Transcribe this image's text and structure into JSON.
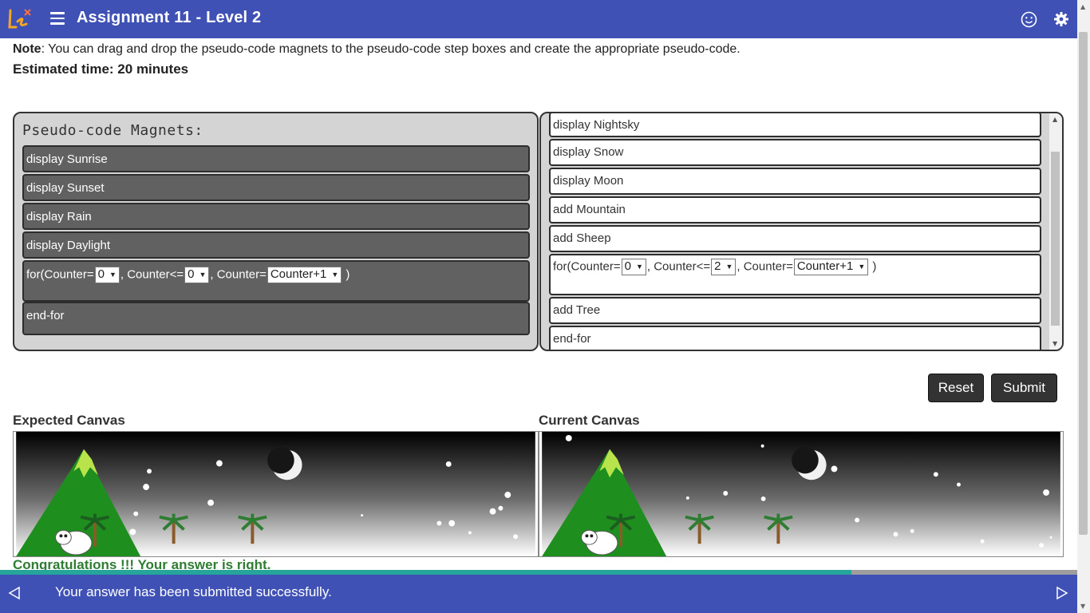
{
  "header": {
    "title": "Assignment 11 - Level 2"
  },
  "note": {
    "label": "Note",
    "text": ": You can drag and drop the pseudo-code magnets to the pseudo-code step boxes and create the appropriate pseudo-code.",
    "estimated": "Estimated time: 20 minutes"
  },
  "magnets": {
    "title": "Pseudo-code Magnets:",
    "items": [
      "display Sunrise",
      "display Sunset",
      "display Rain",
      "display Daylight"
    ],
    "loop": {
      "p1": "for(Counter=",
      "v1": "0",
      "p2": ", Counter<=",
      "v2": "0",
      "p3": ", Counter=",
      "v3": "Counter+1",
      "p4": " )"
    },
    "end": "end-for"
  },
  "steps": {
    "items": [
      "display Nightsky",
      "display Snow",
      "display Moon",
      "add Mountain",
      "add Sheep"
    ],
    "loop": {
      "p1": "for(Counter=",
      "v1": "0",
      "p2": ", Counter<=",
      "v2": "2",
      "p3": ", Counter=",
      "v3": "Counter+1",
      "p4": " )"
    },
    "after": [
      "add Tree",
      "end-for"
    ]
  },
  "buttons": {
    "reset": "Reset",
    "submit": "Submit"
  },
  "canvases": {
    "expected": "Expected Canvas",
    "current": "Current Canvas"
  },
  "result": {
    "message": "Congratulations !!! Your answer is right."
  },
  "progress": {
    "fraction": 0.79
  },
  "footer": {
    "status": "Your answer has been submitted successfully."
  },
  "colors": {
    "brand": "#3f51b5",
    "magnet": "#616161",
    "success": "#2e7d32",
    "progress": "#26a69a"
  }
}
